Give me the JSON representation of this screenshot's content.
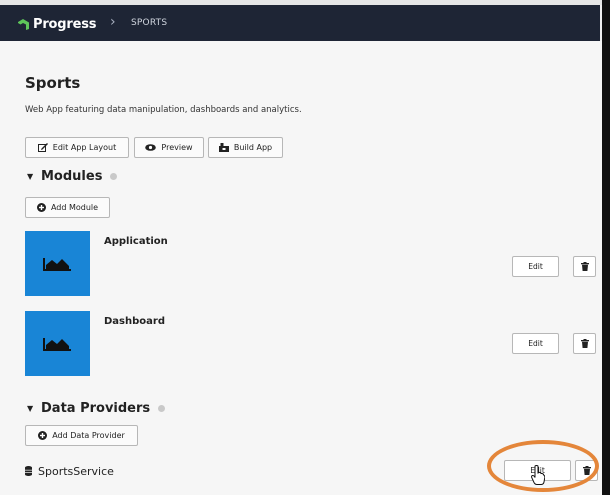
{
  "header": {
    "brand": "Progress",
    "separator": "›",
    "breadcrumb": "SPORTS"
  },
  "page": {
    "title": "Sports",
    "description": "Web App featuring data manipulation, dashboards and analytics."
  },
  "toolbar": {
    "edit_layout": "Edit App Layout",
    "preview": "Preview",
    "build": "Build App"
  },
  "modules": {
    "heading": "Modules",
    "add_button": "Add Module",
    "items": [
      {
        "name": "Application",
        "edit_label": "Edit"
      },
      {
        "name": "Dashboard",
        "edit_label": "Edit"
      }
    ]
  },
  "data_providers": {
    "heading": "Data Providers",
    "add_button": "Add Data Provider",
    "items": [
      {
        "name": "SportsService",
        "edit_label": "Edit"
      }
    ]
  },
  "colors": {
    "topbar": "#1e2535",
    "brand_green": "#5ec55a",
    "tile_blue": "#1985d6",
    "highlight": "#e4863a"
  },
  "icons": {
    "edit_layout": "edit-icon",
    "preview": "eye-icon",
    "build": "build-icon",
    "add": "plus-circle-icon",
    "delete": "trash-icon",
    "module": "area-chart-icon",
    "service": "database-icon",
    "cursor": "hand-pointer-icon"
  }
}
